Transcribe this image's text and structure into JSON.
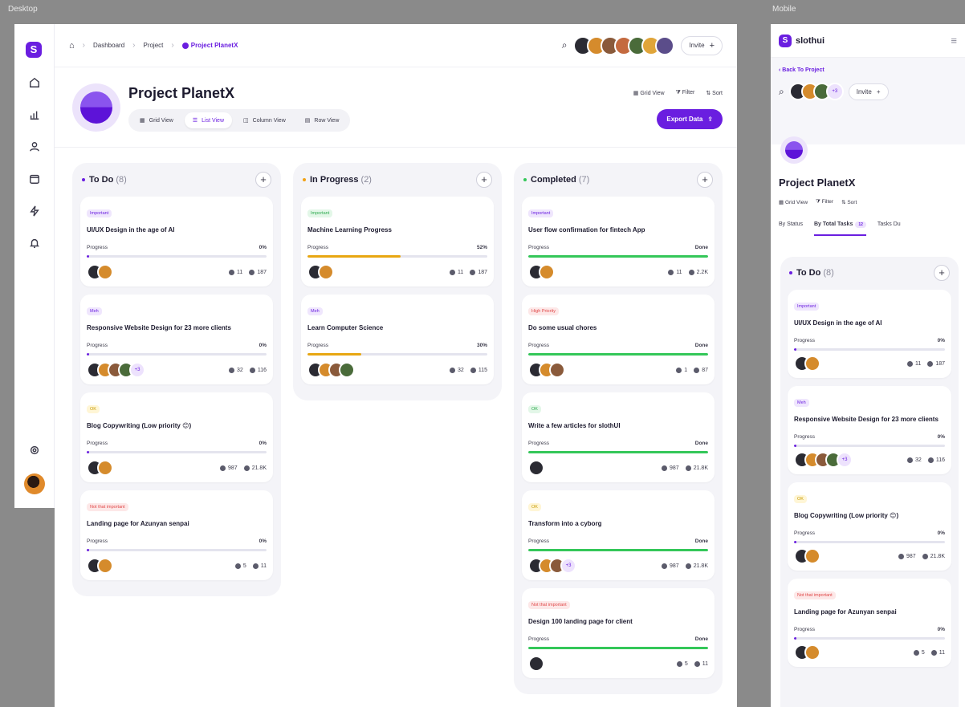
{
  "frames": {
    "desktop": "Desktop",
    "mobile": "Mobile"
  },
  "breadcrumb": {
    "home": "home",
    "items": [
      "Dashboard",
      "Project"
    ],
    "current": "Project PlanetX"
  },
  "invite_label": "Invite",
  "project": {
    "title": "Project PlanetX"
  },
  "views": [
    "Grid View",
    "List View",
    "Column View",
    "Row View"
  ],
  "active_view": "List View",
  "tools": {
    "grid": "Grid View",
    "filter": "Filter",
    "sort": "Sort"
  },
  "export_label": "Export Data",
  "colors": {
    "accent": "#6a1ee0",
    "todo": "#6a1ee0",
    "progress": "#f2a114",
    "done": "#34c759"
  },
  "columns": [
    {
      "title": "To Do",
      "count": "(8)",
      "dot": "#6a1ee0",
      "fill": "#6a1ee0",
      "cards": [
        {
          "tag": "Important",
          "tag_type": "important",
          "title": "UI/UX Design in the age of AI",
          "progress_label": "Progress",
          "progress_text": "0%",
          "progress": 0,
          "avatars": 2,
          "extra": "",
          "comments": "11",
          "files": "187"
        },
        {
          "tag": "Meh",
          "tag_type": "meh",
          "title": "Responsive Website Design for 23 more clients",
          "progress_label": "Progress",
          "progress_text": "0%",
          "progress": 0,
          "avatars": 4,
          "extra": "+3",
          "comments": "32",
          "files": "116"
        },
        {
          "tag": "OK",
          "tag_type": "ok",
          "title": "Blog Copywriting (Low priority 😊)",
          "progress_label": "Progress",
          "progress_text": "0%",
          "progress": 0,
          "avatars": 2,
          "extra": "",
          "comments": "987",
          "files": "21.8K"
        },
        {
          "tag": "Not that important",
          "tag_type": "low",
          "title": "Landing page for Azunyan senpai",
          "progress_label": "Progress",
          "progress_text": "0%",
          "progress": 0,
          "avatars": 2,
          "extra": "",
          "comments": "5",
          "files": "11"
        }
      ]
    },
    {
      "title": "In Progress",
      "count": "(2)",
      "dot": "#f2a114",
      "fill": "#e8a712",
      "cards": [
        {
          "tag": "Important",
          "tag_type": "important_green",
          "title": "Machine Learning Progress",
          "progress_label": "Progress",
          "progress_text": "52%",
          "progress": 52,
          "avatars": 2,
          "extra": "",
          "comments": "11",
          "files": "187"
        },
        {
          "tag": "Meh",
          "tag_type": "meh",
          "title": "Learn Computer Science",
          "progress_label": "Progress",
          "progress_text": "30%",
          "progress": 30,
          "avatars": 4,
          "extra": "",
          "comments": "32",
          "files": "115"
        }
      ]
    },
    {
      "title": "Completed",
      "count": "(7)",
      "dot": "#34c759",
      "fill": "#34c759",
      "cards": [
        {
          "tag": "Important",
          "tag_type": "important",
          "title": "User flow confirmation for fintech App",
          "progress_label": "Progress",
          "progress_text": "Done",
          "progress": 100,
          "avatars": 2,
          "extra": "",
          "comments": "11",
          "files": "2.2K"
        },
        {
          "tag": "High Priority",
          "tag_type": "high",
          "title": "Do some usual chores",
          "progress_label": "Progress",
          "progress_text": "Done",
          "progress": 100,
          "avatars": 3,
          "extra": "",
          "comments": "1",
          "files": "87"
        },
        {
          "tag": "OK",
          "tag_type": "ok_green",
          "title": "Write a few articles for slothUI",
          "progress_label": "Progress",
          "progress_text": "Done",
          "progress": 100,
          "avatars": 1,
          "extra": "",
          "comments": "987",
          "files": "21.8K"
        },
        {
          "tag": "OK",
          "tag_type": "ok",
          "title": "Transform into a cyborg",
          "progress_label": "Progress",
          "progress_text": "Done",
          "progress": 100,
          "avatars": 3,
          "extra": "+3",
          "comments": "987",
          "files": "21.8K"
        },
        {
          "tag": "Not that important",
          "tag_type": "low",
          "title": "Design 100 landing page for client",
          "progress_label": "Progress",
          "progress_text": "Done",
          "progress": 100,
          "avatars": 1,
          "extra": "",
          "comments": "5",
          "files": "11"
        }
      ]
    }
  ],
  "mobile": {
    "brand": "slothui",
    "back": "Back To Project",
    "extra_avatars": "+3",
    "invite_label": "Invite",
    "title": "Project PlanetX",
    "tools": {
      "grid": "Grid View",
      "filter": "Filter",
      "sort": "Sort"
    },
    "tabs": [
      "By Status",
      "By Total Tasks",
      "Tasks Du"
    ],
    "tab_badge": "12",
    "column": {
      "title": "To Do",
      "count": "(8)"
    },
    "cards": [
      {
        "tag": "Important",
        "tag_type": "important",
        "title": "UI/UX Design in the age of AI",
        "progress_label": "Progress",
        "progress_text": "0%",
        "progress": 0,
        "avatars": 2,
        "extra": "",
        "comments": "11",
        "files": "187"
      },
      {
        "tag": "Meh",
        "tag_type": "meh",
        "title": "Responsive Website Design for 23 more clients",
        "progress_label": "Progress",
        "progress_text": "0%",
        "progress": 0,
        "avatars": 4,
        "extra": "+3",
        "comments": "32",
        "files": "116"
      },
      {
        "tag": "OK",
        "tag_type": "ok",
        "title": "Blog Copywriting (Low priority 😊)",
        "progress_label": "Progress",
        "progress_text": "0%",
        "progress": 0,
        "avatars": 2,
        "extra": "",
        "comments": "987",
        "files": "21.8K"
      },
      {
        "tag": "Not that important",
        "tag_type": "low",
        "title": "Landing page for Azunyan senpai",
        "progress_label": "Progress",
        "progress_text": "0%",
        "progress": 0,
        "avatars": 2,
        "extra": "",
        "comments": "5",
        "files": "11"
      }
    ]
  }
}
